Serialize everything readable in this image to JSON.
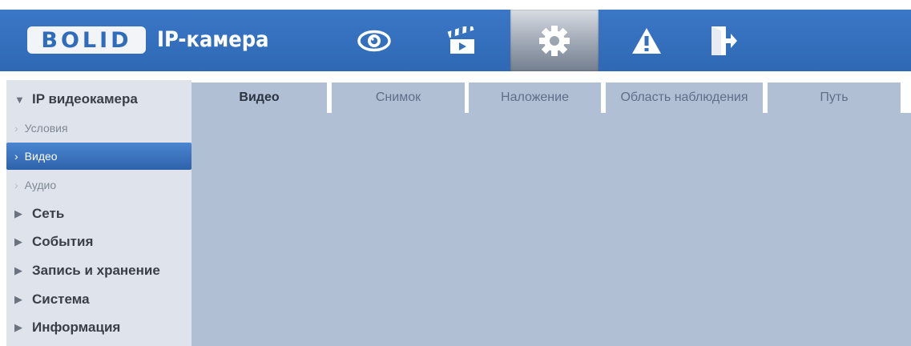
{
  "brand": {
    "logo": "BOLID",
    "title": "IP-камера"
  },
  "nav": [
    {
      "icon": "eye-icon",
      "name": "nav-live",
      "active": false
    },
    {
      "icon": "clapperboard-icon",
      "name": "nav-playback",
      "active": false
    },
    {
      "icon": "gear-icon",
      "name": "nav-settings",
      "active": true
    },
    {
      "icon": "warning-icon",
      "name": "nav-alarm",
      "active": false
    },
    {
      "icon": "exit-icon",
      "name": "nav-logout",
      "active": false
    }
  ],
  "sidebar": {
    "items": [
      {
        "label": "IP видеокамера",
        "level": "top",
        "expanded": true
      },
      {
        "label": "Условия",
        "level": "sub"
      },
      {
        "label": "Видео",
        "level": "sub",
        "active": true
      },
      {
        "label": "Аудио",
        "level": "sub"
      },
      {
        "label": "Сеть",
        "level": "top",
        "expanded": false
      },
      {
        "label": "События",
        "level": "top",
        "expanded": false
      },
      {
        "label": "Запись и хранение",
        "level": "top",
        "expanded": false
      },
      {
        "label": "Система",
        "level": "top",
        "expanded": false
      },
      {
        "label": "Информация",
        "level": "top",
        "expanded": false
      }
    ],
    "expanded_glyph": "▼",
    "collapsed_glyph": "▶",
    "sub_glyph": "›"
  },
  "tabs": [
    {
      "label": "Видео",
      "active": true
    },
    {
      "label": "Снимок"
    },
    {
      "label": "Наложение"
    },
    {
      "label": "Область наблюдения"
    },
    {
      "label": "Путь"
    }
  ],
  "colors": {
    "header": "#3371bf",
    "active_item": "#3a74c2",
    "content_bg": "#b1bfd5",
    "sidebar_bg": "#dfe3eb"
  }
}
